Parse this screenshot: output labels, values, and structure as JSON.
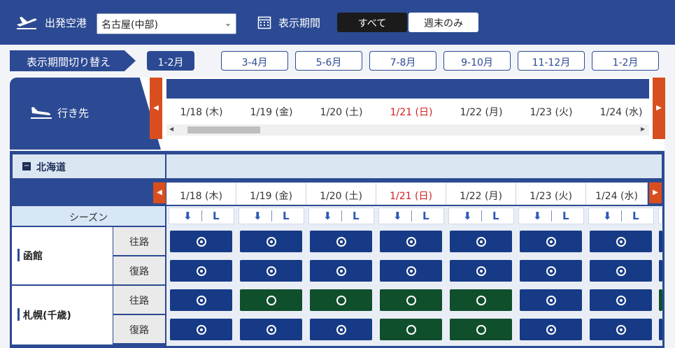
{
  "header": {
    "departure_label": "出発空港",
    "airport_value": "名古屋(中部)",
    "period_label": "表示期間",
    "filter_all": "すべて",
    "filter_weekend": "週末のみ"
  },
  "period_switch": {
    "label": "表示期間切り替え",
    "tabs": [
      "1-2月",
      "3-4月",
      "5-6月",
      "7-8月",
      "9-10月",
      "11-12月",
      "1-2月"
    ],
    "active_index": 0
  },
  "destination": {
    "label": "行き先",
    "dates": [
      "1/18 (木)",
      "1/19 (金)",
      "1/20 (土)",
      "1/21 (日)",
      "1/22 (月)",
      "1/23 (火)",
      "1/24 (水)"
    ],
    "sunday_index": 3
  },
  "table": {
    "region": "北海道",
    "dates": [
      "1/18 (木)",
      "1/19 (金)",
      "1/20 (土)",
      "1/21 (日)",
      "1/22 (月)",
      "1/23 (火)",
      "1/24 (水)"
    ],
    "season_label": "シーズン",
    "season_marks": {
      "arrow": "⬇",
      "letter": "L"
    },
    "rows": [
      {
        "city": "函館",
        "outbound": "往路",
        "return": "復路",
        "outbound_slots": [
          "b",
          "b",
          "b",
          "b",
          "b",
          "b",
          "b"
        ],
        "return_slots": [
          "b",
          "b",
          "b",
          "b",
          "b",
          "b",
          "b"
        ]
      },
      {
        "city": "札幌(千歳)",
        "outbound": "往路",
        "return": "復路",
        "outbound_slots": [
          "b",
          "g",
          "g",
          "g",
          "g",
          "b",
          "b"
        ],
        "return_slots": [
          "b",
          "b",
          "b",
          "g",
          "g",
          "b",
          "b"
        ]
      }
    ]
  },
  "colors": {
    "navy": "#2c4a93",
    "slot_blue": "#173a86",
    "slot_green": "#0f4f2c",
    "sunday": "#d11f1f",
    "nav_orange": "#d94e1f"
  }
}
